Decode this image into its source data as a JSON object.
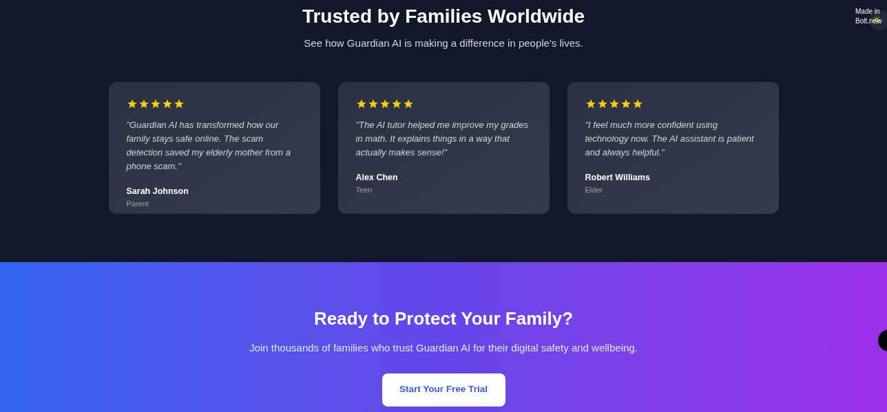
{
  "testimonials_section": {
    "title": "Trusted by Families Worldwide",
    "subtitle": "See how Guardian AI is making a difference in people's lives.",
    "testimonials": [
      {
        "stars": 5,
        "quote": "\"Guardian AI has transformed how our family stays safe online. The scam detection saved my elderly mother from a phone scam.\"",
        "name": "Sarah Johnson",
        "role": "Parent"
      },
      {
        "stars": 5,
        "quote": "\"The AI tutor helped me improve my grades in math. It explains things in a way that actually makes sense!\"",
        "name": "Alex Chen",
        "role": "Teen"
      },
      {
        "stars": 5,
        "quote": "\"I feel much more confident using technology now. The AI assistant is patient and always helpful.\"",
        "name": "Robert Williams",
        "role": "Elder"
      }
    ]
  },
  "badge_alt": "Made in Bolt.new",
  "cta_section": {
    "title": "Ready to Protect Your Family?",
    "text": "Join thousands of families who trust Guardian AI for their digital safety and wellbeing.",
    "button": "Start Your Free Trial"
  }
}
